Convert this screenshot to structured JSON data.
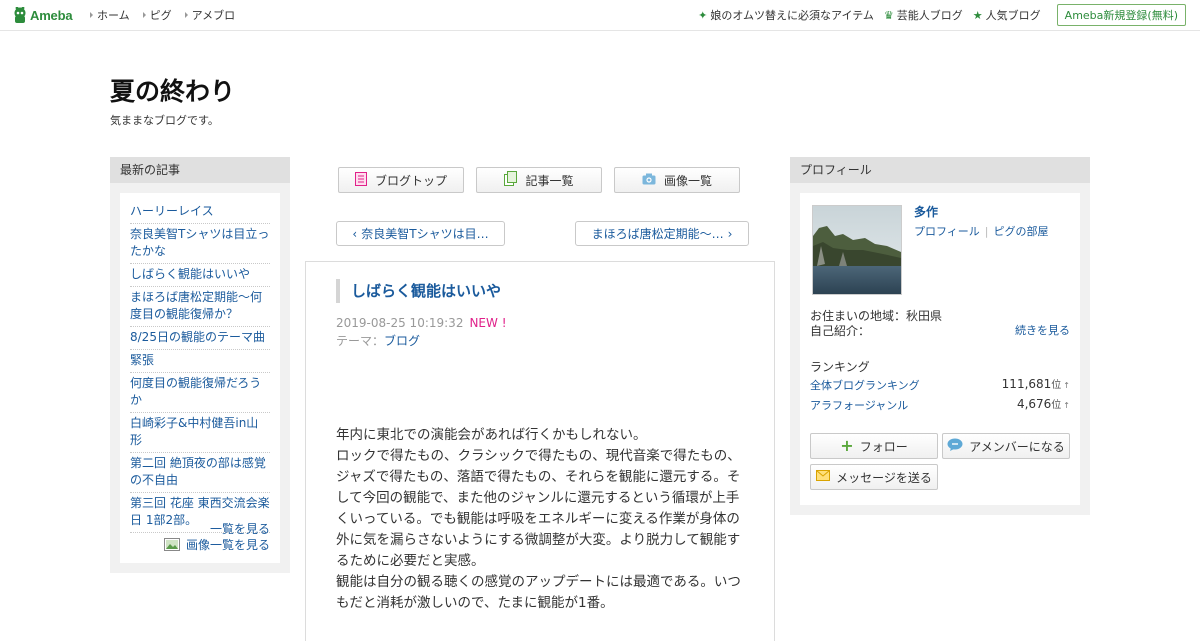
{
  "topbar": {
    "logo": "Ameba",
    "nav": [
      "ホーム",
      "ピグ",
      "アメブロ"
    ],
    "right_links": [
      {
        "label": "娘のオムツ替えに必須なアイテム",
        "icon": "sparkle-icon"
      },
      {
        "label": "芸能人ブログ",
        "icon": "crown-icon"
      },
      {
        "label": "人気ブログ",
        "icon": "star-icon"
      }
    ],
    "signup_label": "Ameba新規登録(無料)"
  },
  "blog": {
    "title": "夏の終わり",
    "description": "気ままなブログです。"
  },
  "left_sidebar": {
    "heading": "最新の記事",
    "items": [
      "ハーリーレイス",
      "奈良美智Tシャツは目立ったかな",
      "しばらく観能はいいや",
      "まほろば唐松定期能〜何度目の観能復帰か？",
      "8/25日の観能のテーマ曲",
      "緊張",
      "何度目の観能復帰だろうか",
      "白崎彩子&中村健吾in山形",
      "第二回 絶頂夜の部は感覚の不自由",
      "第三回 花座 東西交流会楽日 1部2部。"
    ],
    "see_all": "一覧を見る",
    "see_images": "画像一覧を見る"
  },
  "center_nav": {
    "blog_top": "ブログトップ",
    "article_list": "記事一覧",
    "image_list": "画像一覧",
    "prev_article": "奈良美智Tシャツは目…",
    "next_article": "まほろば唐松定期能〜…"
  },
  "article": {
    "title": "しばらく観能はいいや",
    "datetime": "2019-08-25 10:19:32",
    "new_badge": "NEW !",
    "theme_label": "テーマ：",
    "theme": "ブログ",
    "body": "年内に東北での演能会があれば行くかもしれない。\nロックで得たもの、クラシックで得たもの、現代音楽で得たもの、ジャズで得たもの、落語で得たもの、それらを観能に還元する。そして今回の観能で、また他のジャンルに還元するという循環が上手くいっている。でも観能は呼吸をエネルギーに変える作業が身体の外に気を漏らさないようにする微調整が大変。より脱力して観能するために必要だと実感。\n観能は自分の観る聴くの感覚のアップデートには最適である。いつもだと消耗が激しいので、たまに観能が1番。"
  },
  "profile": {
    "heading": "プロフィール",
    "name": "多作",
    "profile_link": "プロフィール",
    "pigg_link": "ピグの部屋",
    "location": "お住まいの地域：秋田県",
    "intro_label": "自己紹介：",
    "continue_link": "続きを見る",
    "ranking_label": "ランキング",
    "rankings": [
      {
        "label": "全体ブログランキング",
        "value": "111,681"
      },
      {
        "label": "アラフォージャンル",
        "value": "4,676"
      }
    ],
    "rank_unit": "位",
    "rank_arrow": "↑",
    "follow": "フォロー",
    "amember": "アメンバーになる",
    "message": "メッセージを送る"
  },
  "colors": {
    "link": "#1a5a9c",
    "ameba_green": "#2d8c3c",
    "new_pink": "#e0218a"
  }
}
